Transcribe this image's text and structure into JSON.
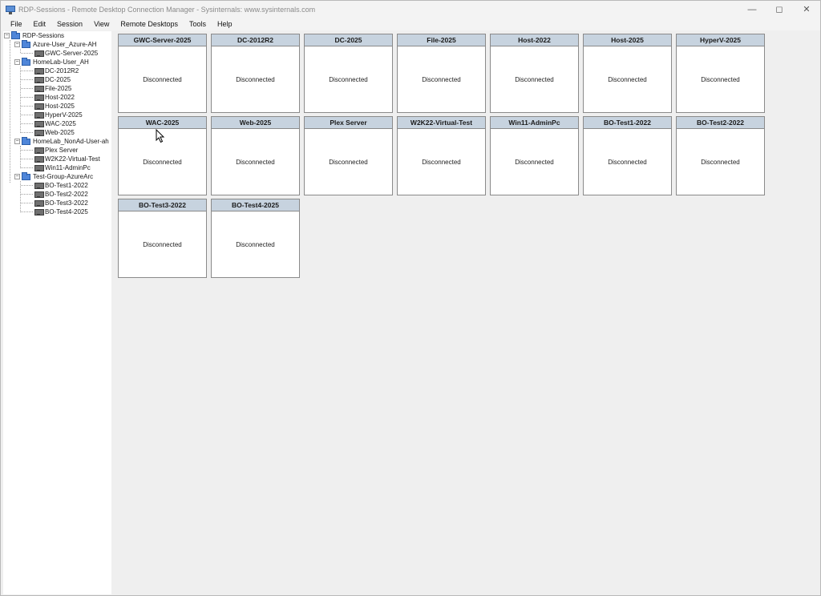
{
  "window": {
    "title": "RDP-Sessions - Remote Desktop Connection Manager - Sysinternals: www.sysinternals.com"
  },
  "menu": [
    "File",
    "Edit",
    "Session",
    "View",
    "Remote Desktops",
    "Tools",
    "Help"
  ],
  "tree": {
    "root": "RDP-Sessions",
    "groups": [
      {
        "label": "Azure-User_Azure-AH",
        "servers": [
          "GWC-Server-2025"
        ]
      },
      {
        "label": "HomeLab-User_AH",
        "servers": [
          "DC-2012R2",
          "DC-2025",
          "File-2025",
          "Host-2022",
          "Host-2025",
          "HyperV-2025",
          "WAC-2025",
          "Web-2025"
        ]
      },
      {
        "label": "HomeLab_NonAd-User-ah",
        "servers": [
          "Plex Server",
          "W2K22-Virtual-Test",
          "Win11-AdminPc"
        ]
      },
      {
        "label": "Test-Group-AzureArc",
        "servers": [
          "BO-Test1-2022",
          "BO-Test2-2022",
          "BO-Test3-2022",
          "BO-Test4-2025"
        ]
      }
    ]
  },
  "tiles": [
    {
      "name": "GWC-Server-2025",
      "status": "Disconnected"
    },
    {
      "name": "DC-2012R2",
      "status": "Disconnected"
    },
    {
      "name": "DC-2025",
      "status": "Disconnected"
    },
    {
      "name": "File-2025",
      "status": "Disconnected"
    },
    {
      "name": "Host-2022",
      "status": "Disconnected"
    },
    {
      "name": "Host-2025",
      "status": "Disconnected"
    },
    {
      "name": "HyperV-2025",
      "status": "Disconnected"
    },
    {
      "name": "WAC-2025",
      "status": "Disconnected"
    },
    {
      "name": "Web-2025",
      "status": "Disconnected"
    },
    {
      "name": "Plex Server",
      "status": "Disconnected"
    },
    {
      "name": "W2K22-Virtual-Test",
      "status": "Disconnected"
    },
    {
      "name": "Win11-AdminPc",
      "status": "Disconnected"
    },
    {
      "name": "BO-Test1-2022",
      "status": "Disconnected"
    },
    {
      "name": "BO-Test2-2022",
      "status": "Disconnected"
    },
    {
      "name": "BO-Test3-2022",
      "status": "Disconnected"
    },
    {
      "name": "BO-Test4-2025",
      "status": "Disconnected"
    }
  ],
  "colors": {
    "tile_header": "#c7d3df",
    "folder": "#4f86d9",
    "background": "#efefef"
  },
  "icons": {
    "minimize": "minimize-icon",
    "maximize": "maximize-icon",
    "close": "close-icon"
  }
}
